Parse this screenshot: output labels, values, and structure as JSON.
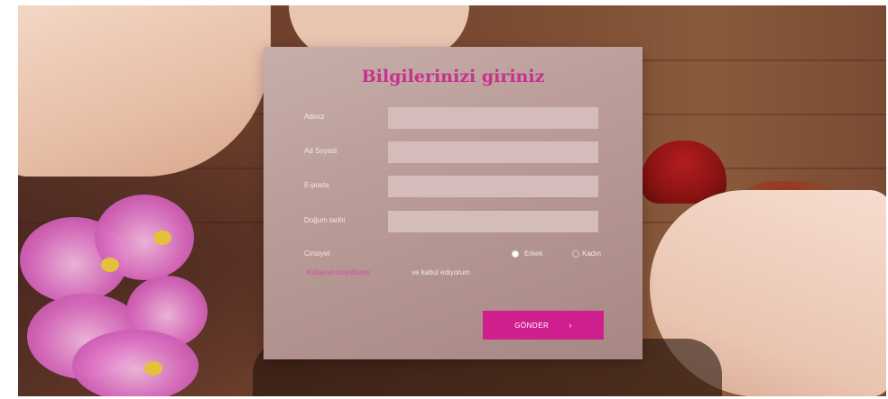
{
  "form": {
    "title": "Bilgilerinizi giriniz",
    "fields": [
      {
        "label": "Adınız",
        "value": "",
        "placeholder": ""
      },
      {
        "label": "Ad Soyadı",
        "value": "",
        "placeholder": ""
      },
      {
        "label": "E-posta",
        "value": "",
        "placeholder": ""
      },
      {
        "label": "Doğum tarihi",
        "value": "",
        "placeholder": ""
      }
    ],
    "gender": {
      "label": "Cinsiyet",
      "options": [
        {
          "label": "Erkek",
          "selected": true
        },
        {
          "label": "Kadın",
          "selected": false
        }
      ]
    },
    "agreement": {
      "link_text": "Kullanım koşullarını",
      "text": "ve kabul ediyorum"
    },
    "submit_label": "GÖNDER",
    "submit_icon": "chevron-right-icon"
  },
  "colors": {
    "accent": "#cf1f8e",
    "title": "#c7318f",
    "card": "#b89a96"
  }
}
